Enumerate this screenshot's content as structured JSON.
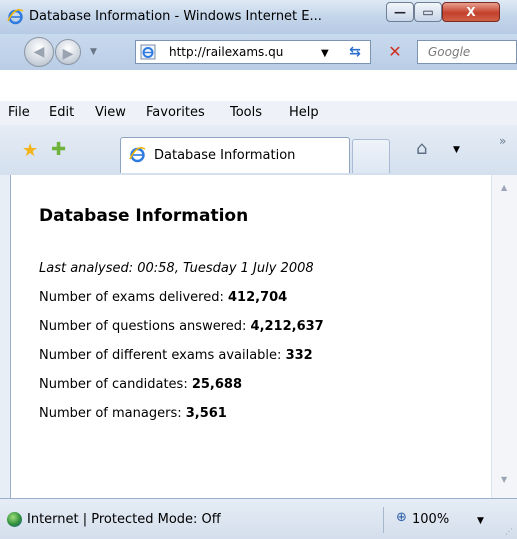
{
  "window": {
    "title": "Database Information - Windows Internet E...",
    "controls": {
      "minimize": "—",
      "maximize": "▭",
      "close": "X"
    }
  },
  "address": {
    "url": "http://railexams.qu",
    "search_placeholder": "Google"
  },
  "menu": [
    "File",
    "Edit",
    "View",
    "Favorites",
    "Tools",
    "Help"
  ],
  "tabs": [
    {
      "label": "Database Information"
    }
  ],
  "page": {
    "title": "Database Information",
    "last_analysed": "Last analysed: 00:58, Tuesday 1 July 2008",
    "stats": [
      {
        "label": "Number of exams delivered: ",
        "value": "412,704"
      },
      {
        "label": "Number of questions answered: ",
        "value": "4,212,637"
      },
      {
        "label": "Number of different exams available: ",
        "value": "332"
      },
      {
        "label": "Number of candidates: ",
        "value": "25,688"
      },
      {
        "label": "Number of managers: ",
        "value": "3,561"
      }
    ]
  },
  "status": {
    "zone": "Internet | Protected Mode: Off",
    "zoom": "100%"
  },
  "icons": {
    "ie": "ie-logo-icon",
    "back": "back-arrow-icon",
    "forward": "forward-arrow-icon",
    "refresh": "refresh-icon",
    "stop": "stop-icon",
    "favorites": "favorites-star-icon",
    "add_favorites": "add-favorites-icon",
    "home": "home-icon",
    "globe": "internet-globe-icon",
    "zoom": "zoom-magnifier-icon"
  }
}
